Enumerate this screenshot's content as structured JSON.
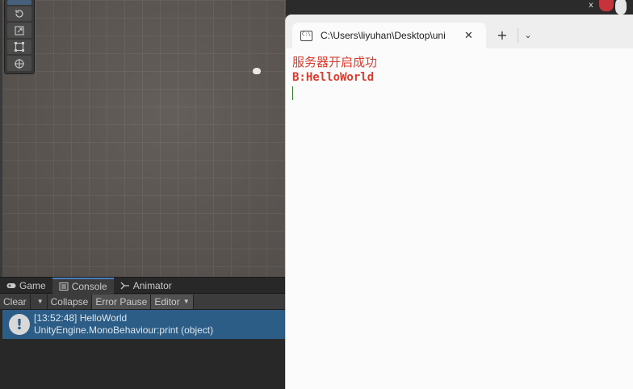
{
  "scene": {
    "gizmo_x_label": "x"
  },
  "console_panel": {
    "tabs": [
      {
        "label": "Game",
        "icon": "gamepad-icon"
      },
      {
        "label": "Console",
        "icon": "console-list-icon"
      },
      {
        "label": "Animator",
        "icon": "animator-icon"
      }
    ],
    "toolbar": {
      "clear": "Clear",
      "collapse": "Collapse",
      "error_pause": "Error Pause",
      "editor": "Editor"
    },
    "log_entry": {
      "line1": "[13:52:48] HelloWorld",
      "line2": "UnityEngine.MonoBehaviour:print (object)",
      "icon": "info-icon",
      "icon_glyph": "!"
    }
  },
  "terminal": {
    "tab_title": "C:\\Users\\liyuhan\\Desktop\\uni",
    "close_glyph": "✕",
    "new_tab_glyph": "+",
    "dropdown_glyph": "⌄",
    "lines": [
      "服务器开启成功",
      "B:HelloWorld"
    ],
    "text_color": "#e03a2c"
  },
  "colors": {
    "selected_row": "#2c5d87",
    "active_tab_accent": "#4a7fc0",
    "terminal_bg": "#fbfbfb"
  }
}
